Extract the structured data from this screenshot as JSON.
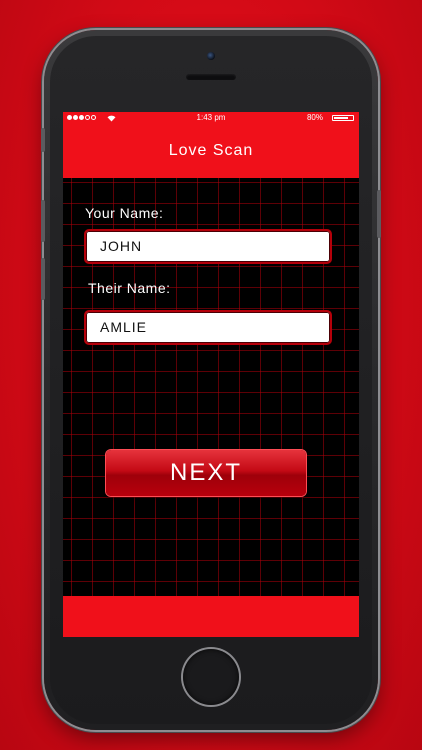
{
  "status_bar": {
    "time": "1:43 pm",
    "battery_percent": "80%",
    "battery_level": 0.8
  },
  "header": {
    "title": "Love Scan"
  },
  "form": {
    "your_name_label": "Your Name:",
    "your_name_value": "JOHN",
    "their_name_label": "Their Name:",
    "their_name_value": "AMLIE",
    "next_label": "NEXT"
  },
  "icons": {
    "signal": "signal-dots-icon",
    "wifi": "wifi-icon",
    "battery": "battery-icon"
  },
  "colors": {
    "brand_red": "#f0101a",
    "background": "#000000"
  }
}
